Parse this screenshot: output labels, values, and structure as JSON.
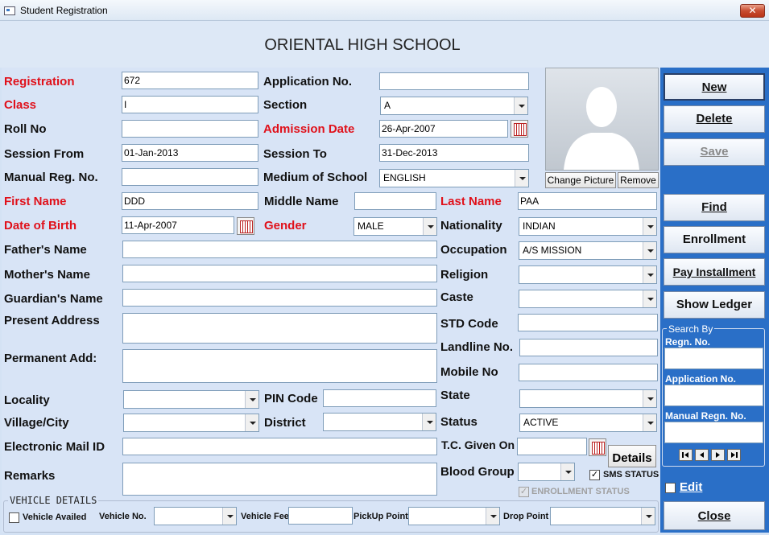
{
  "window": {
    "title": "Student Registration",
    "close": "✕"
  },
  "school": "ORIENTAL HIGH SCHOOL",
  "labels": {
    "registration": "Registration",
    "application_no": "Application No.",
    "class": "Class",
    "section": "Section",
    "roll_no": "Roll No",
    "admission_date": "Admission Date",
    "session_from": "Session From",
    "session_to": "Session To",
    "manual_reg_no": "Manual Reg. No.",
    "medium": "Medium of School",
    "first_name": "First Name",
    "middle_name": "Middle Name",
    "last_name": "Last Name",
    "dob": "Date of Birth",
    "gender": "Gender",
    "nationality": "Nationality",
    "father": "Father's Name",
    "occupation": "Occupation",
    "mother": "Mother's Name",
    "religion": "Religion",
    "guardian": "Guardian's Name",
    "caste": "Caste",
    "present_address": "Present Address",
    "std_code": "STD Code",
    "permanent_add": "Permanent Add:",
    "landline": "Landline No.",
    "mobile": "Mobile No",
    "locality": "Locality",
    "pin_code": "PIN Code",
    "state": "State",
    "village": "Village/City",
    "district": "District",
    "status": "Status",
    "email": "Electronic Mail ID",
    "tc_given": "T.C. Given On",
    "remarks": "Remarks",
    "blood_group": "Blood Group"
  },
  "values": {
    "registration": "672",
    "application_no": "",
    "class": "I",
    "section": "A",
    "roll_no": "",
    "admission_date": "26-Apr-2007",
    "session_from": "01-Jan-2013",
    "session_to": "31-Dec-2013",
    "manual_reg_no": "",
    "medium": "ENGLISH",
    "first_name": "DDD",
    "middle_name": "",
    "last_name": "PAA",
    "dob": "11-Apr-2007",
    "gender": "MALE",
    "nationality": "INDIAN",
    "occupation": "A/S MISSION",
    "status": "ACTIVE"
  },
  "photo": {
    "change": "Change Picture",
    "change_ul": "P",
    "remove": "Remove"
  },
  "side": {
    "new": "New",
    "delete": "Delete",
    "save": "Save",
    "find": "Find",
    "enrollment": "Enrollment",
    "pay_installment": "Pay Installment",
    "show_ledger": "Show Ledger",
    "search_by": "Search By",
    "regn_no": "Regn. No.",
    "application_no": "Application No.",
    "manual_regn_no": "Manual Regn. No.",
    "edit": "Edit",
    "close": "Close"
  },
  "details_btn": "Details",
  "sms_status": "SMS STATUS",
  "enrollment_status": "ENROLLMENT STATUS",
  "vehicle": {
    "group": "VEHICLE DETAILS",
    "availed": "Vehicle Availed",
    "vehicle_no": "Vehicle No.",
    "vehicle_fee": "Vehicle Fee",
    "pickup": "PickUp Point",
    "drop": "Drop Point"
  }
}
